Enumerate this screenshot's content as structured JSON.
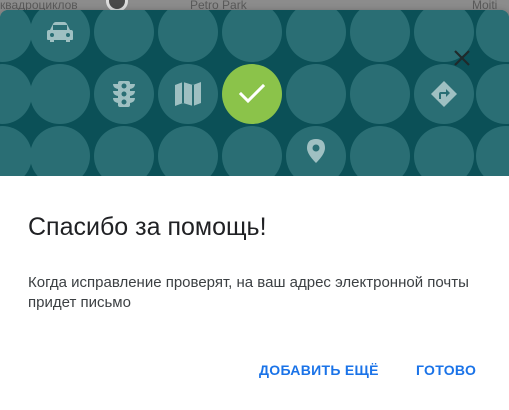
{
  "background_map": {
    "label_left": "квадроциклов",
    "label_center": "Petro Park",
    "label_right": "Moiti"
  },
  "dialog": {
    "title": "Спасибо за помощь!",
    "message": "Когда исправление проверят, на ваш адрес электронной почты придет письмо",
    "add_more_label": "ДОБАВИТЬ ЕЩЁ",
    "done_label": "ГОТОВО"
  },
  "header": {
    "icons": [
      "car-icon",
      "traffic-light-icon",
      "map-icon",
      "check-icon",
      "directions-icon",
      "place-icon",
      "close-icon"
    ]
  },
  "colors": {
    "header_bg": "#0b5057",
    "circle_bg": "#2a6e74",
    "check_bg": "#8bc34a",
    "icon_fill": "#9fc0c2",
    "button_text": "#1a73e8",
    "title_text": "#202124",
    "body_text": "#3c4043"
  }
}
